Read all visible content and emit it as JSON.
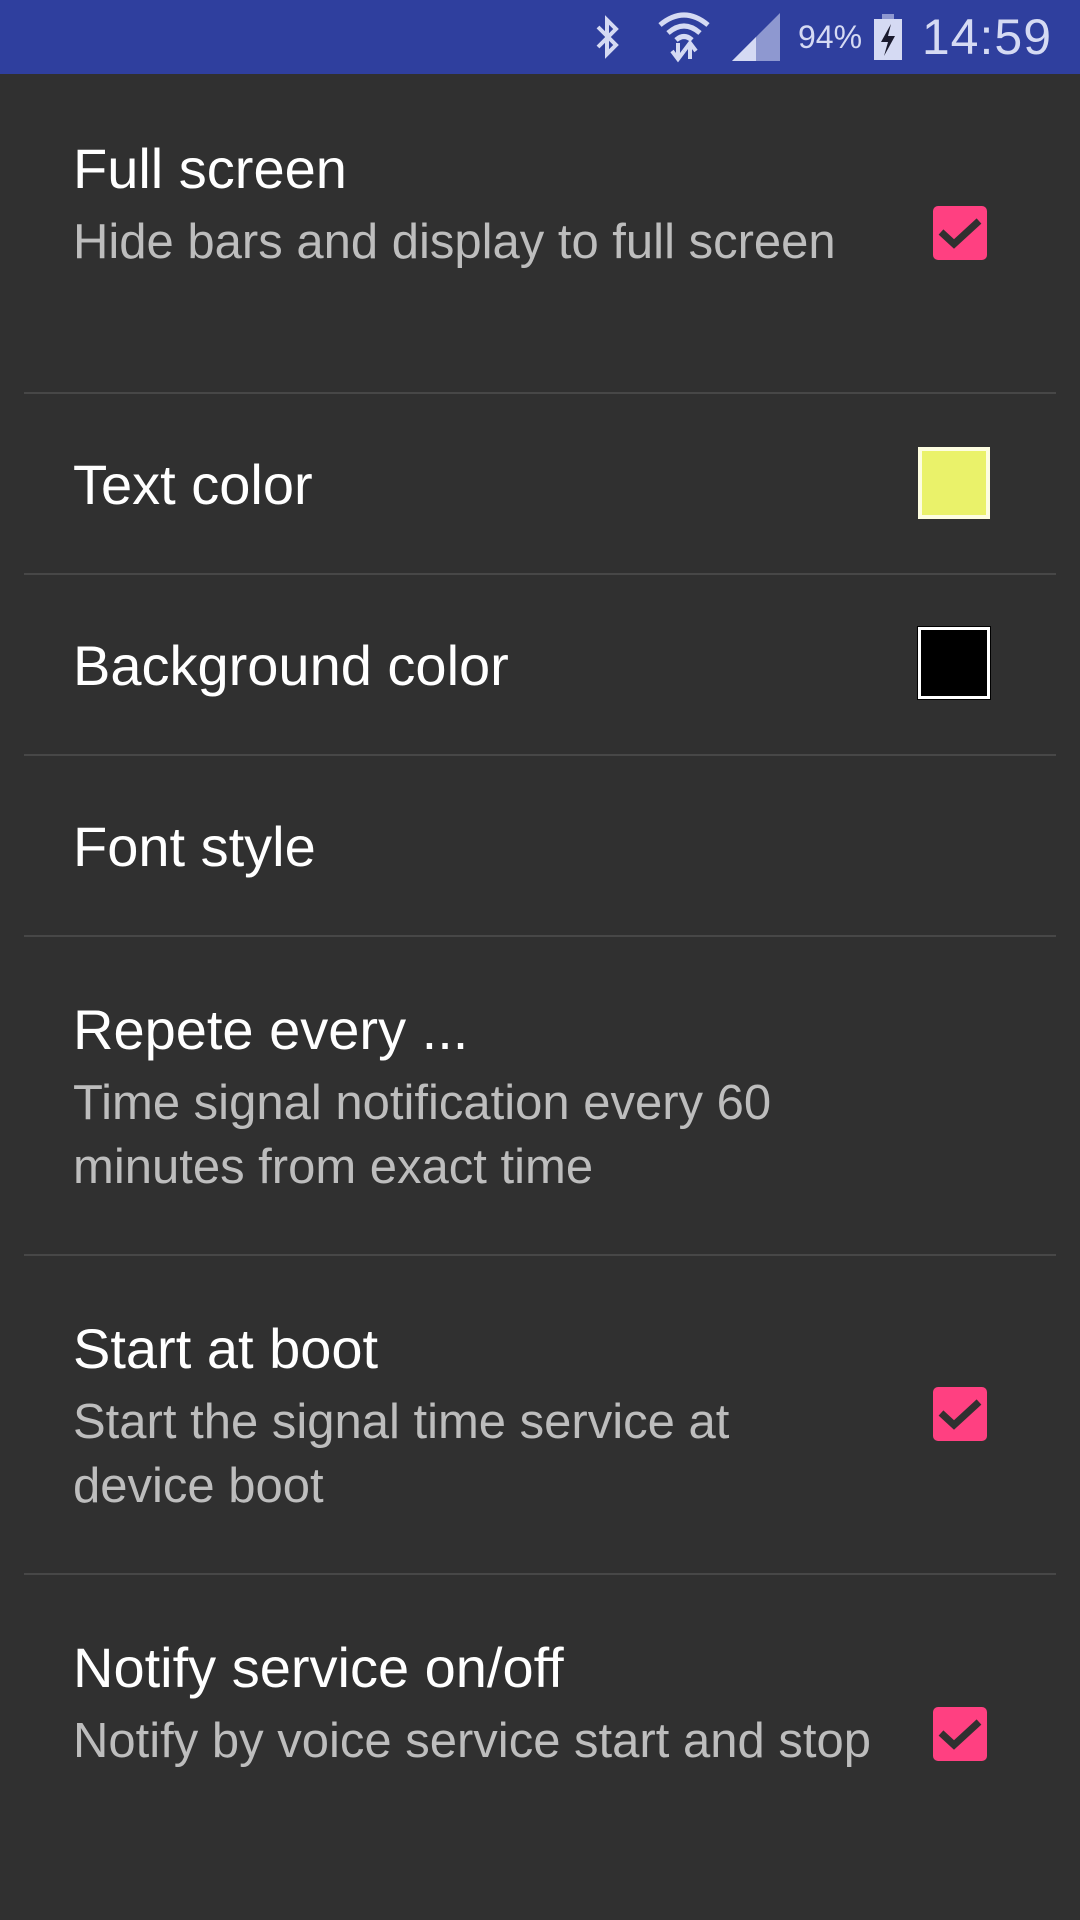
{
  "status_bar": {
    "icons": [
      "bluetooth-icon",
      "wifi-data-icon",
      "cellular-signal-icon",
      "battery-charging-icon"
    ],
    "battery_percent": "94%",
    "time": "14:59",
    "background_color": "#2f3f9e"
  },
  "preferences": [
    {
      "title": "Full screen",
      "summary": "Hide bars and display to full screen",
      "widget": "checkbox",
      "checked": true
    },
    {
      "title": "Text color",
      "summary": "",
      "widget": "color-swatch",
      "color": "#eaf26a"
    },
    {
      "title": "Background color",
      "summary": "",
      "widget": "color-swatch",
      "color": "#000000"
    },
    {
      "title": "Font style",
      "summary": "",
      "widget": "none"
    },
    {
      "title": "Repete every ...",
      "summary": "Time signal notification every 60 minutes from exact time",
      "widget": "none"
    },
    {
      "title": "Start at boot",
      "summary": "Start the signal time service at device boot",
      "widget": "checkbox",
      "checked": true
    },
    {
      "title": "Notify service on/off",
      "summary": "Notify by voice service start and stop",
      "widget": "checkbox",
      "checked": true
    }
  ],
  "accent_color": "#ff4081",
  "background_color": "#303030"
}
